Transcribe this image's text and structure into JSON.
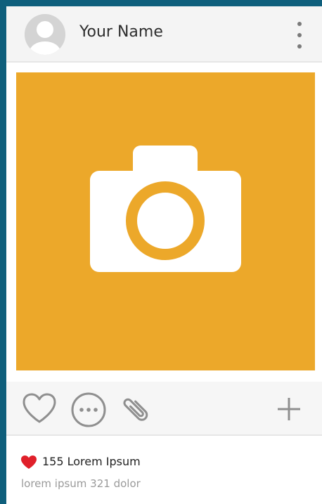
{
  "header": {
    "user_name": "Your Name",
    "avatar_icon": "user-avatar-icon",
    "menu_icon": "vertical-dots-icon"
  },
  "post": {
    "image_icon": "camera-icon",
    "image_color": "#eca82a"
  },
  "actions": {
    "icons": [
      "heart-outline-icon",
      "comment-icon",
      "paperclip-icon",
      "plus-icon"
    ]
  },
  "footer": {
    "likes_icon": "heart-filled-icon",
    "likes_color": "#e0202a",
    "likes_text": "155 Lorem Ipsum",
    "caption": "lorem ipsum 321 dolor"
  },
  "colors": {
    "frame_border": "#0f5f7c",
    "icon_gray": "#8f8f8f"
  }
}
